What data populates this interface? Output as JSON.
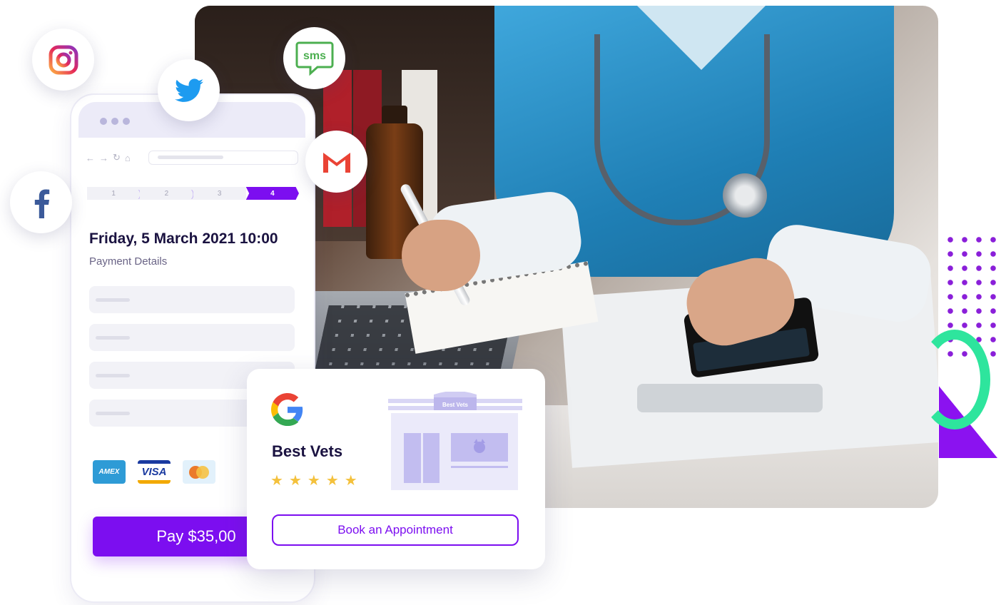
{
  "phone": {
    "steps": [
      "1",
      "2",
      "3",
      "4"
    ],
    "active_step": "4",
    "appointment_datetime": "Friday, 5 March 2021 10:00",
    "section_title": "Payment Details",
    "card_brands": [
      "AMEX",
      "VISA",
      "mastercard-icon"
    ],
    "pay_button": "Pay $35,00"
  },
  "social_icons": [
    "instagram-icon",
    "twitter-icon",
    "sms-icon",
    "gmail-icon",
    "facebook-icon"
  ],
  "sms_label": "sms",
  "business_card": {
    "provider_icon": "google-icon",
    "business_name": "Best Vets",
    "rating": 5,
    "rating_max": 5,
    "storefront_sign": "Best Vets",
    "book_button": "Book an Appointment"
  },
  "colors": {
    "accent": "#7c0ef0",
    "dark_text": "#1a1240",
    "star": "#f4c13c",
    "decor_green": "#2ee59d"
  }
}
